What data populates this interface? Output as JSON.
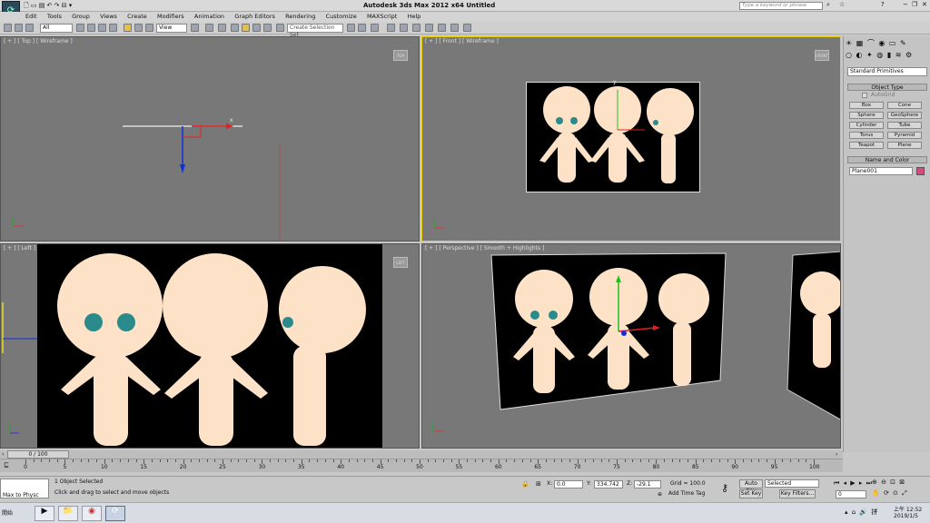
{
  "app": {
    "title": "Autodesk 3ds Max  2012 x64     Untitled",
    "search_placeholder": "Type a keyword or phrase"
  },
  "menu": [
    "Edit",
    "Tools",
    "Group",
    "Views",
    "Create",
    "Modifiers",
    "Animation",
    "Graph Editors",
    "Rendering",
    "Customize",
    "MAXScript",
    "Help"
  ],
  "toolbar": {
    "filter": "All",
    "refcoord": "View",
    "selset": "Create Selection Set"
  },
  "viewports": {
    "top": {
      "label": "[ + ] [ Top ] [ Wireframe ]",
      "cube": "TOP"
    },
    "front": {
      "label": "[ + ] [ Front ] [ Wireframe ]",
      "cube": "FRONT"
    },
    "left": {
      "label": "[ + ] [ Left ] [ Smooth + Highlights ]",
      "cube": "LEFT"
    },
    "persp": {
      "label": "[ + ] [ Perspective ] [ Smooth + Highlights ]"
    }
  },
  "axis": {
    "x": "x",
    "y": "y",
    "z": "z"
  },
  "command_panel": {
    "category": "Standard Primitives",
    "object_type": "Object Type",
    "autogrid": "AutoGrid",
    "primitives": [
      "Box",
      "Cone",
      "Sphere",
      "GeoSphere",
      "Cylinder",
      "Tube",
      "Torus",
      "Pyramid",
      "Teapot",
      "Plane"
    ],
    "name_color": "Name and Color",
    "object_name": "Plane001",
    "object_color": "#d84880"
  },
  "timeline": {
    "slider": "0 / 100",
    "ticks": [
      "0",
      "5",
      "10",
      "15",
      "20",
      "25",
      "30",
      "35",
      "40",
      "45",
      "50",
      "55",
      "60",
      "65",
      "70",
      "75",
      "80",
      "85",
      "90",
      "95",
      "100"
    ]
  },
  "status": {
    "maxscript": "Max to Physc",
    "selected": "1 Object Selected",
    "prompt": "Click and drag to select and move objects",
    "x_label": "X:",
    "x": "0.0",
    "y_label": "Y:",
    "y": "334.742",
    "z_label": "Z:",
    "z": "-29.1",
    "grid": "Grid = 100.0",
    "add_time_tag": "Add Time Tag",
    "auto_key": "Auto Key",
    "key_mode": "Selected",
    "set_key": "Set Key",
    "key_filters": "Key Filters...",
    "frame": "0"
  },
  "taskbar": {
    "start": "開始",
    "time": "上午 12:52",
    "date": "2019/1/5"
  }
}
